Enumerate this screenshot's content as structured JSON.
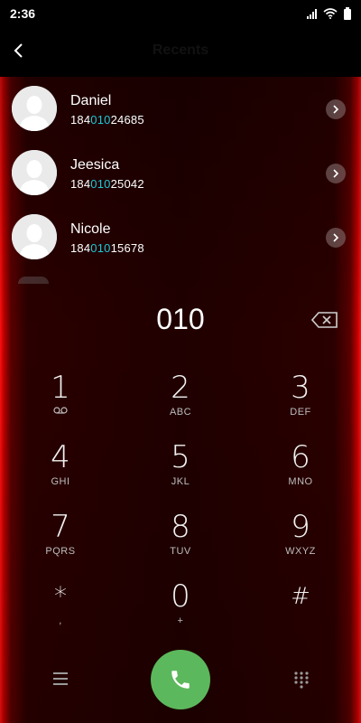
{
  "status_bar": {
    "time": "2:36"
  },
  "header": {
    "title": "Recents"
  },
  "recents": [
    {
      "name": "Daniel",
      "number_prefix": "184",
      "number_match": "010",
      "number_suffix": "24685"
    },
    {
      "name": "Jeesica",
      "number_prefix": "184",
      "number_match": "010",
      "number_suffix": "25042"
    },
    {
      "name": "Nicole",
      "number_prefix": "184",
      "number_match": "010",
      "number_suffix": "15678"
    }
  ],
  "dial": {
    "value": "010"
  },
  "keypad": [
    {
      "digit": "1",
      "letters": ""
    },
    {
      "digit": "2",
      "letters": "ABC"
    },
    {
      "digit": "3",
      "letters": "DEF"
    },
    {
      "digit": "4",
      "letters": "GHI"
    },
    {
      "digit": "5",
      "letters": "JKL"
    },
    {
      "digit": "6",
      "letters": "MNO"
    },
    {
      "digit": "7",
      "letters": "PQRS"
    },
    {
      "digit": "8",
      "letters": "TUV"
    },
    {
      "digit": "9",
      "letters": "WXYZ"
    },
    {
      "digit": "*",
      "letters": ","
    },
    {
      "digit": "0",
      "letters": "+"
    },
    {
      "digit": "#",
      "letters": ""
    }
  ],
  "colors": {
    "accent_glow": "#ff1010",
    "match_highlight": "#1ec8d8",
    "call_button": "#5cb85c"
  },
  "icons": {
    "back": "chevron-left-icon",
    "backspace": "backspace-icon",
    "voicemail": "voicemail-icon",
    "menu": "menu-icon",
    "call": "phone-icon",
    "keypad_toggle": "dialpad-icon"
  }
}
